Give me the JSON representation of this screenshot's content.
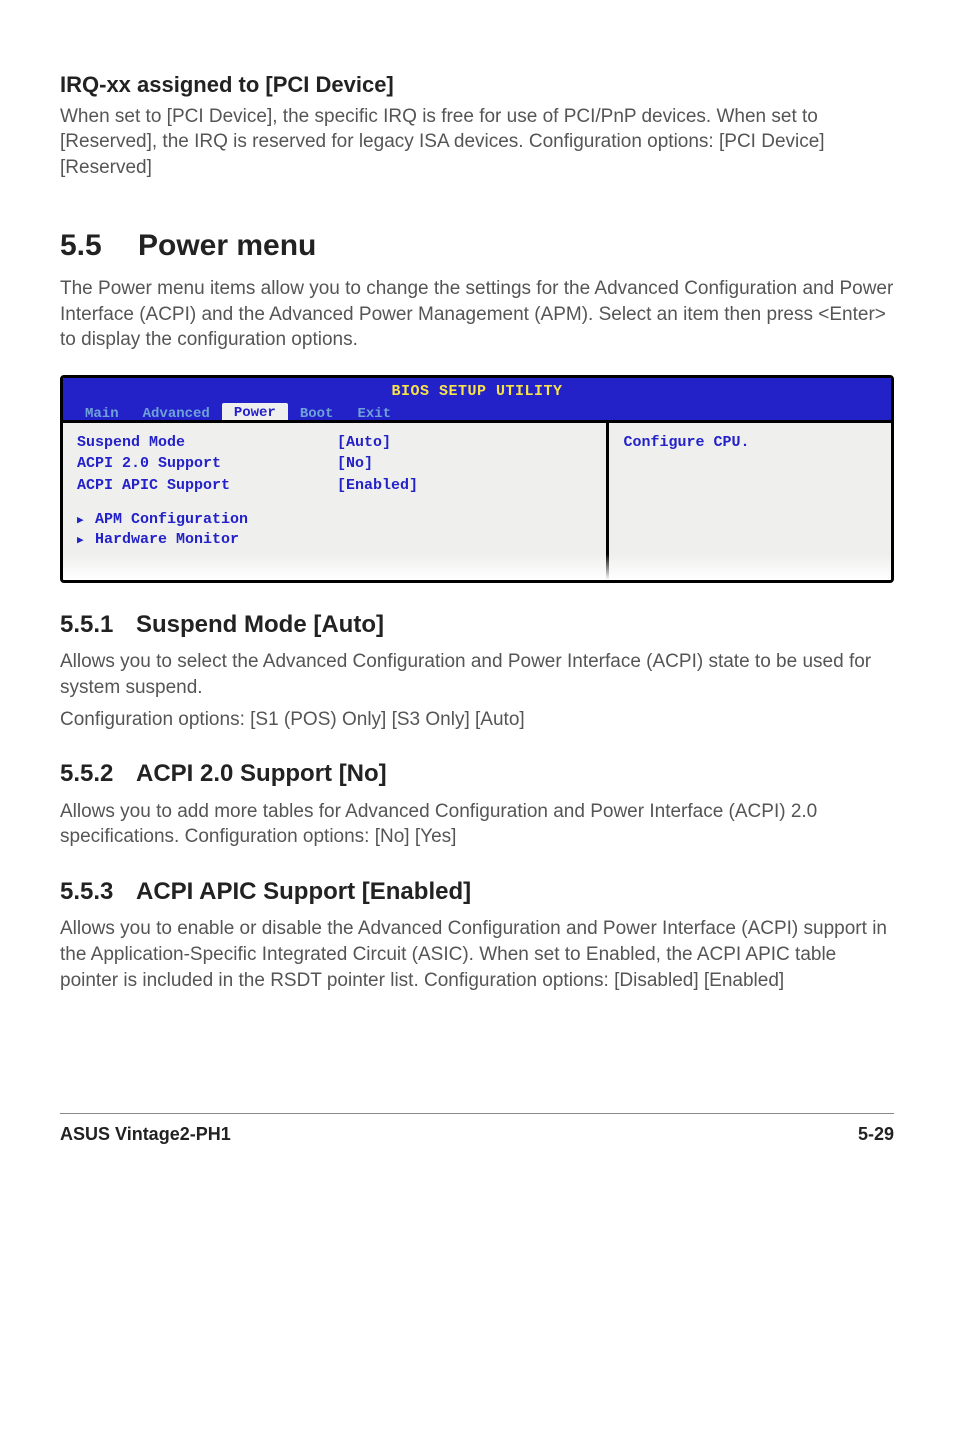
{
  "irq": {
    "heading": "IRQ-xx assigned to [PCI Device]",
    "body": "When set to [PCI Device], the specific IRQ is free for use of PCI/PnP devices. When set to [Reserved], the IRQ is reserved for legacy ISA devices. Configuration options: [PCI Device] [Reserved]"
  },
  "section": {
    "number": "5.5",
    "title": "Power menu",
    "intro": "The Power menu items allow you to change the settings for the Advanced Configuration and Power Interface (ACPI) and the Advanced Power Management (APM). Select an item then press <Enter> to display the configuration options."
  },
  "bios": {
    "title": "BIOS SETUP UTILITY",
    "tabs": [
      "Main",
      "Advanced",
      "Power",
      "Boot",
      "Exit"
    ],
    "selected_tab": "Power",
    "rows": [
      {
        "label": "Suspend Mode",
        "value": "[Auto]"
      },
      {
        "label": "ACPI 2.0 Support",
        "value": "[No]"
      },
      {
        "label": "ACPI APIC Support",
        "value": "[Enabled]"
      }
    ],
    "submenus": [
      "APM Configuration",
      "Hardware Monitor"
    ],
    "right_text": "Configure CPU."
  },
  "sub1": {
    "num": "5.5.1",
    "title": "Suspend Mode [Auto]",
    "body1": "Allows you to select the Advanced Configuration and Power Interface (ACPI) state to be used for system suspend.",
    "body2": "Configuration options: [S1 (POS) Only] [S3 Only] [Auto]"
  },
  "sub2": {
    "num": "5.5.2",
    "title": "ACPI 2.0 Support [No]",
    "body": "Allows you to add more tables for Advanced Configuration and Power Interface (ACPI) 2.0 specifications. Configuration options: [No] [Yes]"
  },
  "sub3": {
    "num": "5.5.3",
    "title": "ACPI APIC Support [Enabled]",
    "body": "Allows you to enable or disable the Advanced Configuration and Power Interface (ACPI) support in the Application-Specific Integrated Circuit (ASIC). When set to Enabled, the ACPI APIC table pointer is included in the RSDT pointer list. Configuration options: [Disabled] [Enabled]"
  },
  "footer": {
    "left": "ASUS Vintage2-PH1",
    "right": "5-29"
  }
}
